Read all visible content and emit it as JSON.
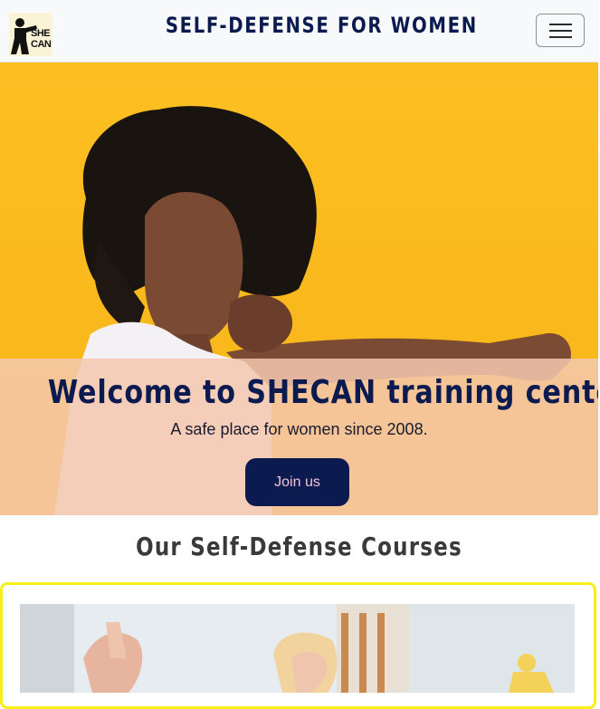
{
  "navbar": {
    "logo_text_line1": "SHE",
    "logo_text_line2": "CAN",
    "title": "SELF-DEFENSE FOR WOMEN",
    "menu_icon": "hamburger-menu-icon"
  },
  "hero": {
    "heading": "Welcome to SHECAN training center!",
    "subheading": "A safe place for women since 2008.",
    "cta_label": "Join us"
  },
  "courses": {
    "title": "Our Self-Defense Courses"
  },
  "colors": {
    "navy": "#0b1a4f",
    "hero_background": "#fbbd1e",
    "card_border": "#f7ef18",
    "overlay": "#f5c8af"
  }
}
